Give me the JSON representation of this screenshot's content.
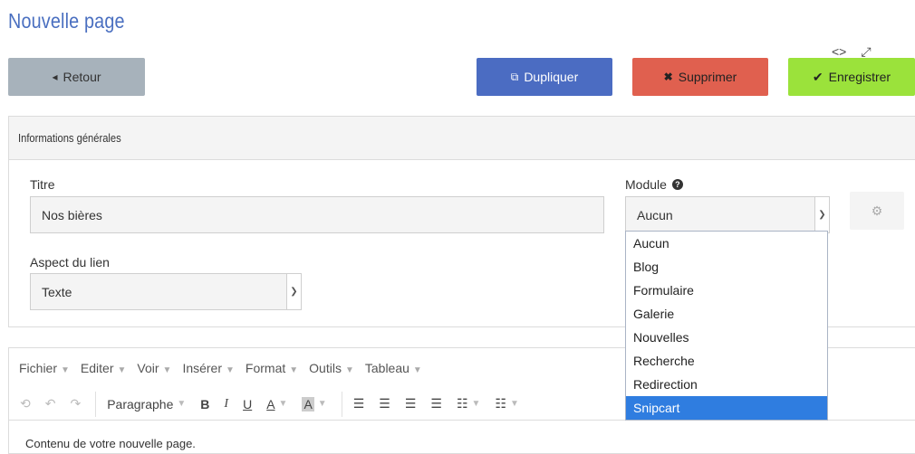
{
  "page": {
    "title": "Nouvelle page"
  },
  "actions": {
    "back": "Retour",
    "duplicate": "Dupliquer",
    "delete": "Supprimer",
    "save": "Enregistrer"
  },
  "panel": {
    "heading": "Informations générales",
    "title_label": "Titre",
    "title_value": "Nos bières",
    "link_label": "Aspect du lien",
    "link_value": "Texte",
    "module_label": "Module",
    "module_value": "Aucun"
  },
  "module_options": [
    "Aucun",
    "Blog",
    "Formulaire",
    "Galerie",
    "Nouvelles",
    "Recherche",
    "Redirection",
    "Snipcart"
  ],
  "module_highlighted": "Snipcart",
  "editor": {
    "menu": [
      "Fichier",
      "Editer",
      "Voir",
      "Insérer",
      "Format",
      "Outils",
      "Tableau"
    ],
    "format_label": "Paragraphe",
    "content": "Contenu de votre nouvelle page."
  },
  "colors": {
    "title": "#4a6fc0",
    "back": "#a7b2bb",
    "duplicate": "#4b6cc2",
    "delete": "#e0604f",
    "save": "#9be23b",
    "highlight": "#2f7de0"
  }
}
